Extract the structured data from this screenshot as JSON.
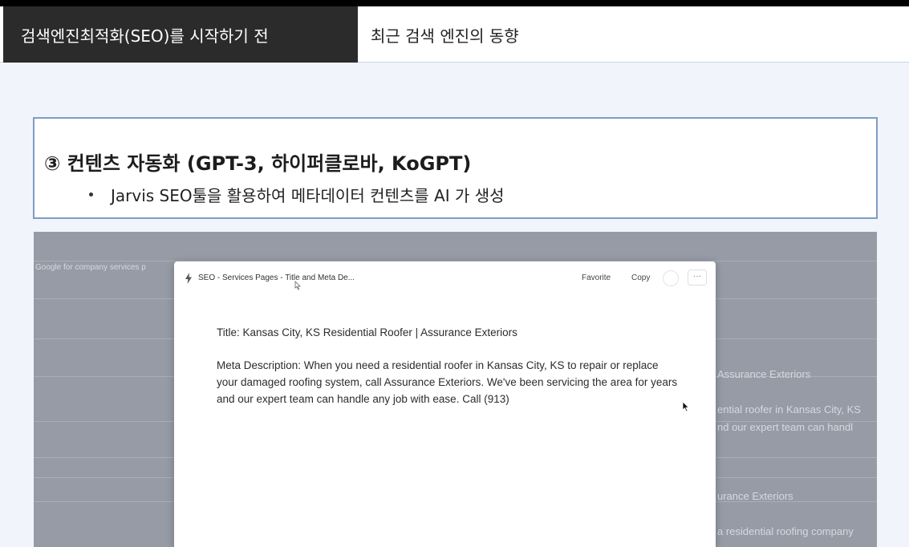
{
  "tabs": {
    "active": "검색엔진최적화(SEO)를 시작하기 전",
    "other": "최근 검색 엔진의 동향"
  },
  "heading": {
    "title": "③ 컨텐츠 자동화 (GPT-3, 하이퍼클로바, KoGPT)",
    "bullet": "Jarvis SEO툴을 활용하여 메타데이터 컨텐츠를 AI 가 생성"
  },
  "background_app": {
    "left_label": "Google for company services p",
    "right_lines": [
      "Assurance Exteriors",
      "ential roofer in Kansas City, KS",
      "nd our expert team can handl",
      "urance Exteriors",
      "a residential roofing company"
    ]
  },
  "modal": {
    "title": "SEO - Services Pages - Title and Meta De...",
    "favorite_label": "Favorite",
    "copy_label": "Copy",
    "more_label": "···",
    "output_title": "Title: Kansas City, KS Residential Roofer | Assurance Exteriors",
    "output_meta": "Meta Description: When you need a residential roofer in Kansas City, KS to repair or replace your damaged roofing system, call Assurance Exteriors. We've been servicing the area for years and our expert team can handle any job with ease. Call (913)"
  },
  "icons": {
    "bolt": "bolt-icon",
    "cursor": "cursor-icon",
    "text_cursor": "text-cursor-icon"
  },
  "colors": {
    "tab_active_bg": "#2b2b2b",
    "heading_border": "#7f9cc6",
    "screenshot_bg": "#969ba6"
  }
}
